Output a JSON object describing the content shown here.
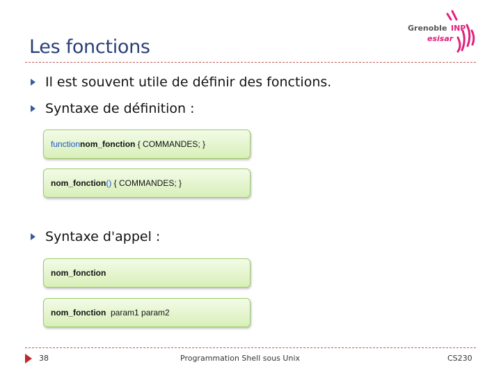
{
  "slide": {
    "title": "Les fonctions"
  },
  "logo": {
    "line1": "Grenoble",
    "line1b": "INP",
    "line2": "esisar"
  },
  "bullets": [
    "Il est souvent utile de définir des fonctions.",
    "Syntaxe de définition :",
    "Syntaxe d'appel :"
  ],
  "code": {
    "def1": {
      "kw": "function",
      "name": "nom_fonction",
      "rest": " { COMMANDES; }"
    },
    "def2": {
      "name": "nom_fonction",
      "parens": "()",
      "rest": " { COMMANDES; }"
    },
    "call1": {
      "name": "nom_fonction"
    },
    "call2": {
      "name": "nom_fonction",
      "rest": "  param1 param2"
    }
  },
  "footer": {
    "page": "38",
    "course": "Programmation Shell sous Unix",
    "code": "CS230"
  },
  "colors": {
    "title": "#2a3f78",
    "rule": "#c25a55",
    "bullet_arrow": "#3b5a9a",
    "box_border": "#9ccc65",
    "keyword": "#2255cc",
    "logo_accent": "#e0207c",
    "footer_arrow": "#c0272d"
  }
}
